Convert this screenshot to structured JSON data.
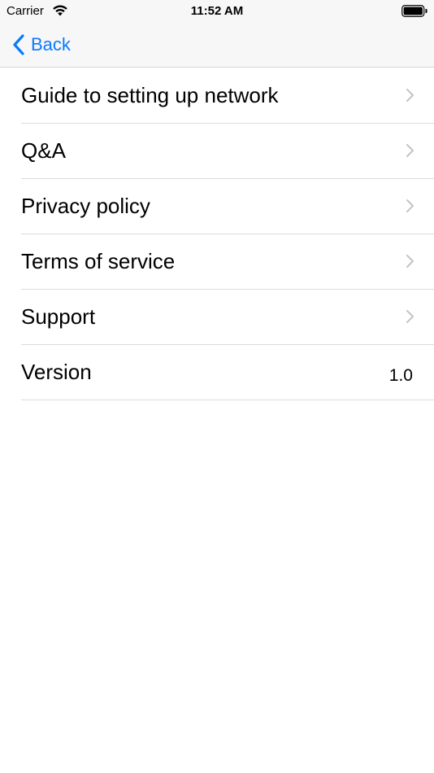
{
  "status_bar": {
    "carrier": "Carrier",
    "time": "11:52 AM",
    "icons": [
      "wifi-icon",
      "battery-icon"
    ]
  },
  "nav": {
    "back_label": "Back",
    "accent_color": "#0a7aff"
  },
  "menu": {
    "items": [
      {
        "label": "Guide to setting up network",
        "icon": "chevron-right-icon"
      },
      {
        "label": "Q&A",
        "icon": "chevron-right-icon"
      },
      {
        "label": "Privacy policy",
        "icon": "chevron-right-icon"
      },
      {
        "label": "Terms of service",
        "icon": "chevron-right-icon"
      },
      {
        "label": "Support",
        "icon": "chevron-right-icon"
      }
    ],
    "version": {
      "label": "Version",
      "value": "1.0"
    }
  }
}
